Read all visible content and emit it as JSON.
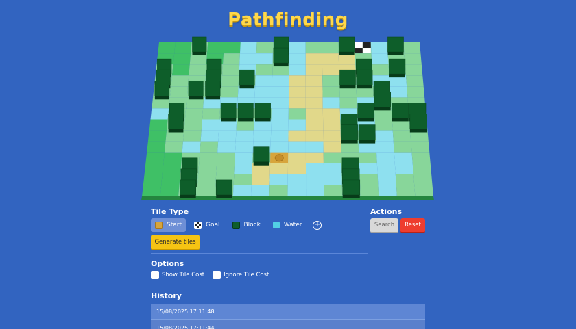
{
  "app": {
    "title": "Pathfinding"
  },
  "colors": {
    "background": "#3264c0",
    "title": "#ffd84a",
    "grass": "#88d69a",
    "grass_dark": "#3fc066",
    "water": "#8ee0ef",
    "path": "#e1d88a",
    "block": "#0e5e2a",
    "start": "#d7a53c",
    "selected_tool": "#6e8fd6",
    "generate_button": "#f5c413",
    "reset_button": "#ee3d2f",
    "search_button": "#d9d9d9"
  },
  "tile_type": {
    "label": "Tile Type",
    "tools": [
      {
        "id": "start",
        "label": "Start",
        "icon": "start-tile-icon",
        "selected": true
      },
      {
        "id": "goal",
        "label": "Goal",
        "icon": "checkered-flag-icon",
        "selected": false
      },
      {
        "id": "block",
        "label": "Block",
        "icon": "block-tile-icon",
        "selected": false
      },
      {
        "id": "water",
        "label": "Water",
        "icon": "water-tile-icon",
        "selected": false
      }
    ],
    "add_icon": "add-circle-icon",
    "generate_label": "Generate tiles"
  },
  "actions": {
    "label": "Actions",
    "search_label": "Search",
    "reset_label": "Reset"
  },
  "options": {
    "label": "Options",
    "show_tile_cost": {
      "label": "Show Tile Cost",
      "checked": false
    },
    "ignore_tile_cost": {
      "label": "Ignore Tile Cost",
      "checked": false
    }
  },
  "history": {
    "label": "History",
    "entries": [
      "15/08/2025 17:11:48",
      "15/08/2025 17:11:44"
    ]
  },
  "grid": {
    "cols": 16,
    "rows": 15,
    "legend": {
      "G": "grass",
      "D": "grass_dark",
      "W": "water",
      "P": "path",
      "B": "block",
      "S": "start",
      "F": "goal"
    },
    "map": [
      "DDBDDWGBWGGBFWBG",
      "DDGDGWWBWPPPGWGG",
      "BDGBGWGGWPPPBGBG",
      "BGGBGBWWPPGBBWWG",
      "BGBBGWWWPPGGGBWG",
      "GGGWWWWWPPWGWBGG",
      "WBGGBBBWGPPWBGBBD",
      "DBGWWGWWWPPBWGGBD",
      "DGGWWWWWPPPBBWGGB",
      "DGWGWWWWWWPGWWGGBG",
      "DDGGGWBSPPGGGWWGBG",
      "DDBGGWPPPWWBWWWGGG",
      "DDBGGGPWWWWBGWGGGG",
      "DDBGBWWGWWGBGWGGGB"
    ]
  }
}
